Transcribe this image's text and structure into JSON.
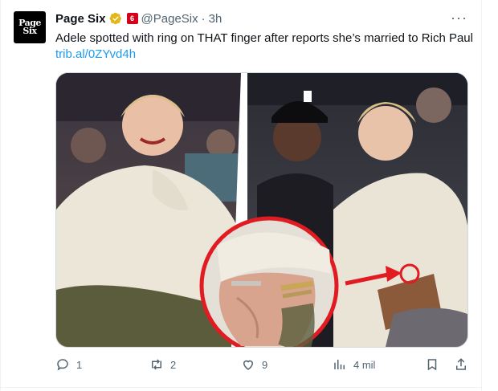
{
  "tweet": {
    "avatar_text_line1": "Page",
    "avatar_text_line2": "Six",
    "author_name": "Page Six",
    "handle": "@PageSix",
    "separator": "·",
    "time": "3h",
    "more": "···",
    "affiliate_badge": "6",
    "text": "Adele spotted with ring on THAT finger after reports she’s married to Rich Paul ",
    "link": "trib.al/0ZYvd4h"
  },
  "actions": {
    "replies": "1",
    "retweets": "2",
    "likes": "9",
    "views": "4 mil"
  },
  "colors": {
    "link": "#1d9bf0",
    "muted": "#536471",
    "verified_gold": "#e2b719",
    "affiliate_red": "#d5001c"
  },
  "icons": [
    "reply-icon",
    "retweet-icon",
    "like-icon",
    "views-icon",
    "bookmark-icon",
    "share-icon",
    "verified-badge-icon",
    "more-options-icon"
  ]
}
